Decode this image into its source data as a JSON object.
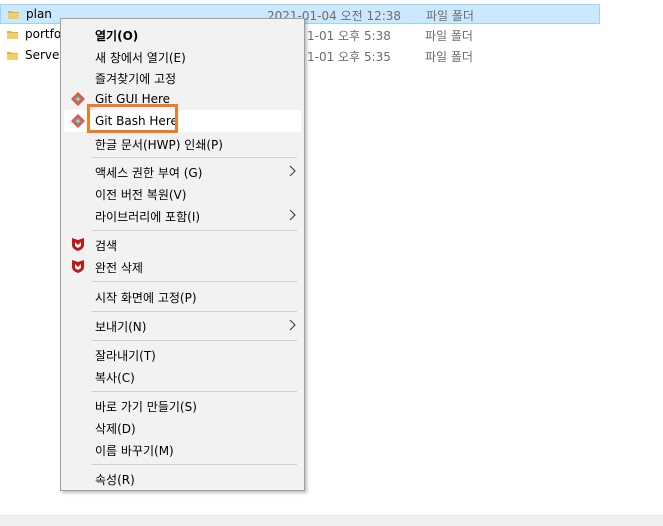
{
  "files": [
    {
      "name": "plan",
      "date": "2021-01-04 오전 12:38",
      "type": "파일 폴더",
      "selected": true
    },
    {
      "name": "portfol",
      "date": "1-01 오후 5:38",
      "type": "파일 폴더",
      "selected": false
    },
    {
      "name": "Servers",
      "date": "1-01 오후 5:35",
      "type": "파일 폴더",
      "selected": false
    }
  ],
  "menu": {
    "open": "열기(O)",
    "open_new_window": "새 창에서 열기(E)",
    "pin_quick_access": "즐겨찾기에 고정",
    "git_gui": "Git GUI Here",
    "git_bash": "Git Bash Here",
    "hwp_print": "한글 문서(HWP) 인쇄(P)",
    "give_access": "액세스 권한 부여 (G)",
    "restore_previous": "이전 버전 복원(V)",
    "include_library": "라이브러리에 포함(I)",
    "scan": "검색",
    "shred": "완전 삭제",
    "pin_start": "시작 화면에 고정(P)",
    "send_to": "보내기(N)",
    "cut": "잘라내기(T)",
    "copy": "복사(C)",
    "create_shortcut": "바로 가기 만들기(S)",
    "delete": "삭제(D)",
    "rename": "이름 바꾸기(M)",
    "properties": "속성(R)"
  },
  "colors": {
    "selection_bg": "#cce8ff",
    "highlight_box": "#f07a26",
    "folder": "#dcb449",
    "mcafee_red": "#c01818"
  },
  "icons": {
    "folder": "folder-icon",
    "git": "git-icon",
    "mcafee": "mcafee-shield-icon",
    "submenu": "chevron-right-icon"
  }
}
